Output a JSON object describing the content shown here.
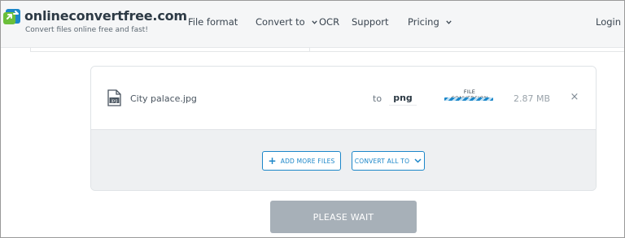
{
  "header": {
    "logo_text": "onlineconvertfree.com",
    "tagline": "Convert files online free and fast!",
    "nav": {
      "file_format": "File format",
      "convert_to": "Convert to",
      "ocr": "OCR",
      "support": "Support",
      "pricing": "Pricing",
      "login": "Login"
    }
  },
  "file": {
    "icon_label": "jpg",
    "name": "City palace.jpg",
    "to_label": "to",
    "target_format": "png",
    "status_label": "FILE CONVERSION",
    "size": "2.87 MB",
    "remove_glyph": "×"
  },
  "actions": {
    "add_more_label": "ADD MORE FILES",
    "add_glyph": "+",
    "convert_all_label": "CONVERT ALL TO"
  },
  "wait_label": "PLEASE WAIT",
  "colors": {
    "accent": "#1c87c9",
    "logo_green": "#6bbf3a",
    "logo_blue": "#1c87c9",
    "wait_button": "#a7b0b8"
  },
  "icons": [
    "logo-arrows-icon",
    "jpg-file-icon",
    "chevron-down-icon",
    "plus-icon",
    "close-icon"
  ]
}
